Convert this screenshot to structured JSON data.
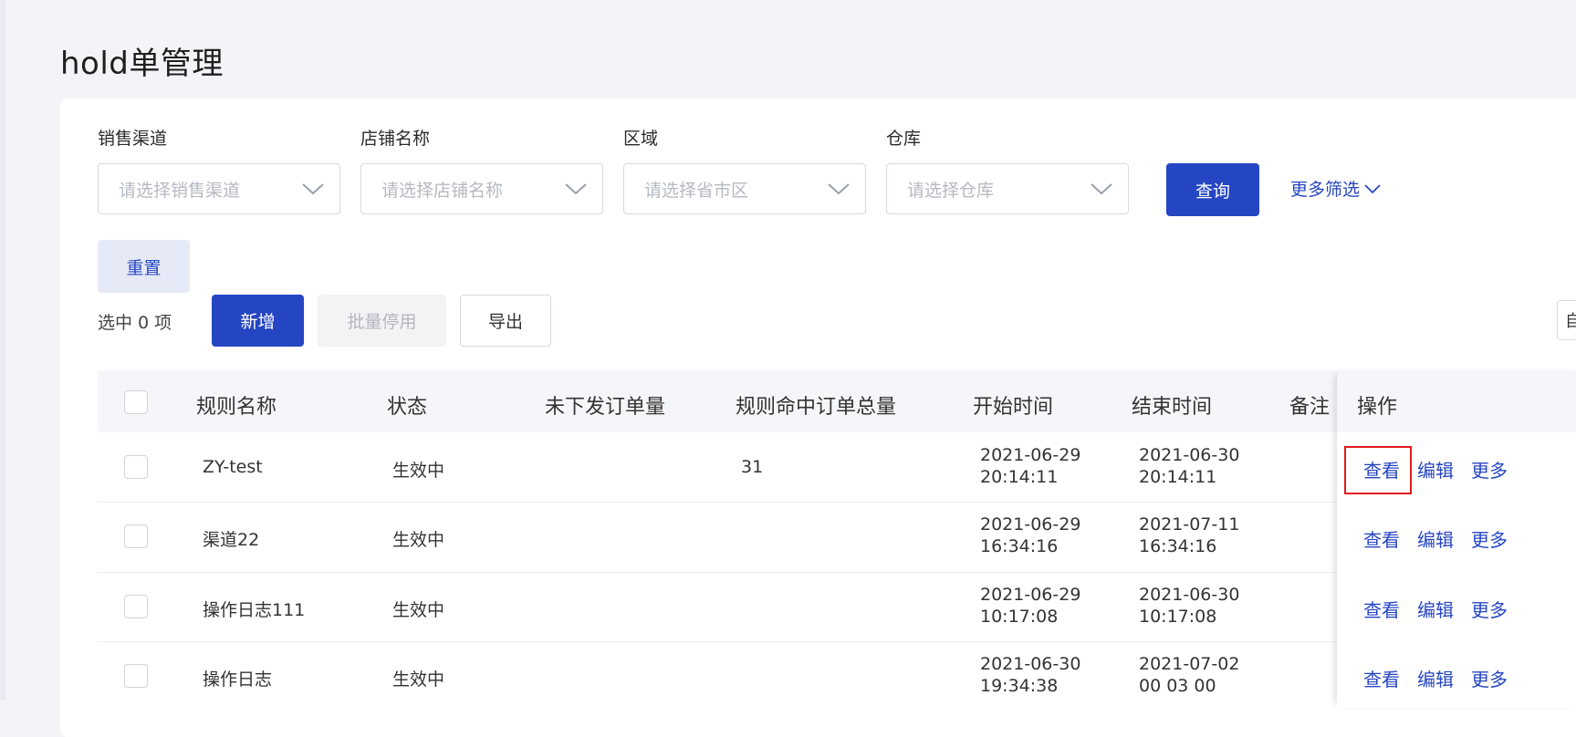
{
  "page": {
    "title": "hold单管理"
  },
  "filters": [
    {
      "label": "销售渠道",
      "placeholder": "请选择销售渠道"
    },
    {
      "label": "店铺名称",
      "placeholder": "请选择店铺名称"
    },
    {
      "label": "区域",
      "placeholder": "请选择省市区"
    },
    {
      "label": "仓库",
      "placeholder": "请选择仓库"
    }
  ],
  "actions": {
    "query": "查询",
    "more_filters": "更多筛选",
    "reset": "重置",
    "selected": "选中 0 项",
    "add": "新增",
    "batch_disable": "批量停用",
    "export": "导出",
    "edge_button": "自"
  },
  "table": {
    "columns": [
      "规则名称",
      "状态",
      "未下发订单量",
      "规则命中订单总量",
      "开始时间",
      "结束时间",
      "备注",
      "操作"
    ],
    "rows": [
      {
        "name": "ZY-test",
        "status": "生效中",
        "pending": "",
        "hits": "31",
        "start_date": "2021-06-29",
        "start_time": "20:14:11",
        "end_date": "2021-06-30",
        "end_time": "20:14:11",
        "note": ""
      },
      {
        "name": "渠道22",
        "status": "生效中",
        "pending": "",
        "hits": "",
        "start_date": "2021-06-29",
        "start_time": "16:34:16",
        "end_date": "2021-07-11",
        "end_time": "16:34:16",
        "note": ""
      },
      {
        "name": "操作日志111",
        "status": "生效中",
        "pending": "",
        "hits": "",
        "start_date": "2021-06-29",
        "start_time": "10:17:08",
        "end_date": "2021-06-30",
        "end_time": "10:17:08",
        "note": ""
      },
      {
        "name": "操作日志",
        "status": "生效中",
        "pending": "",
        "hits": "",
        "start_date": "2021-06-30",
        "start_time": "19:34:38",
        "end_date": "2021-07-02",
        "end_time": "00 03 00",
        "note": ""
      }
    ],
    "row_actions": {
      "view": "查看",
      "edit": "编辑",
      "more": "更多"
    }
  },
  "colors": {
    "primary": "#2546c3",
    "highlight": "#e21b1b"
  },
  "icons": {
    "dropdown": "chevron-down-icon"
  }
}
